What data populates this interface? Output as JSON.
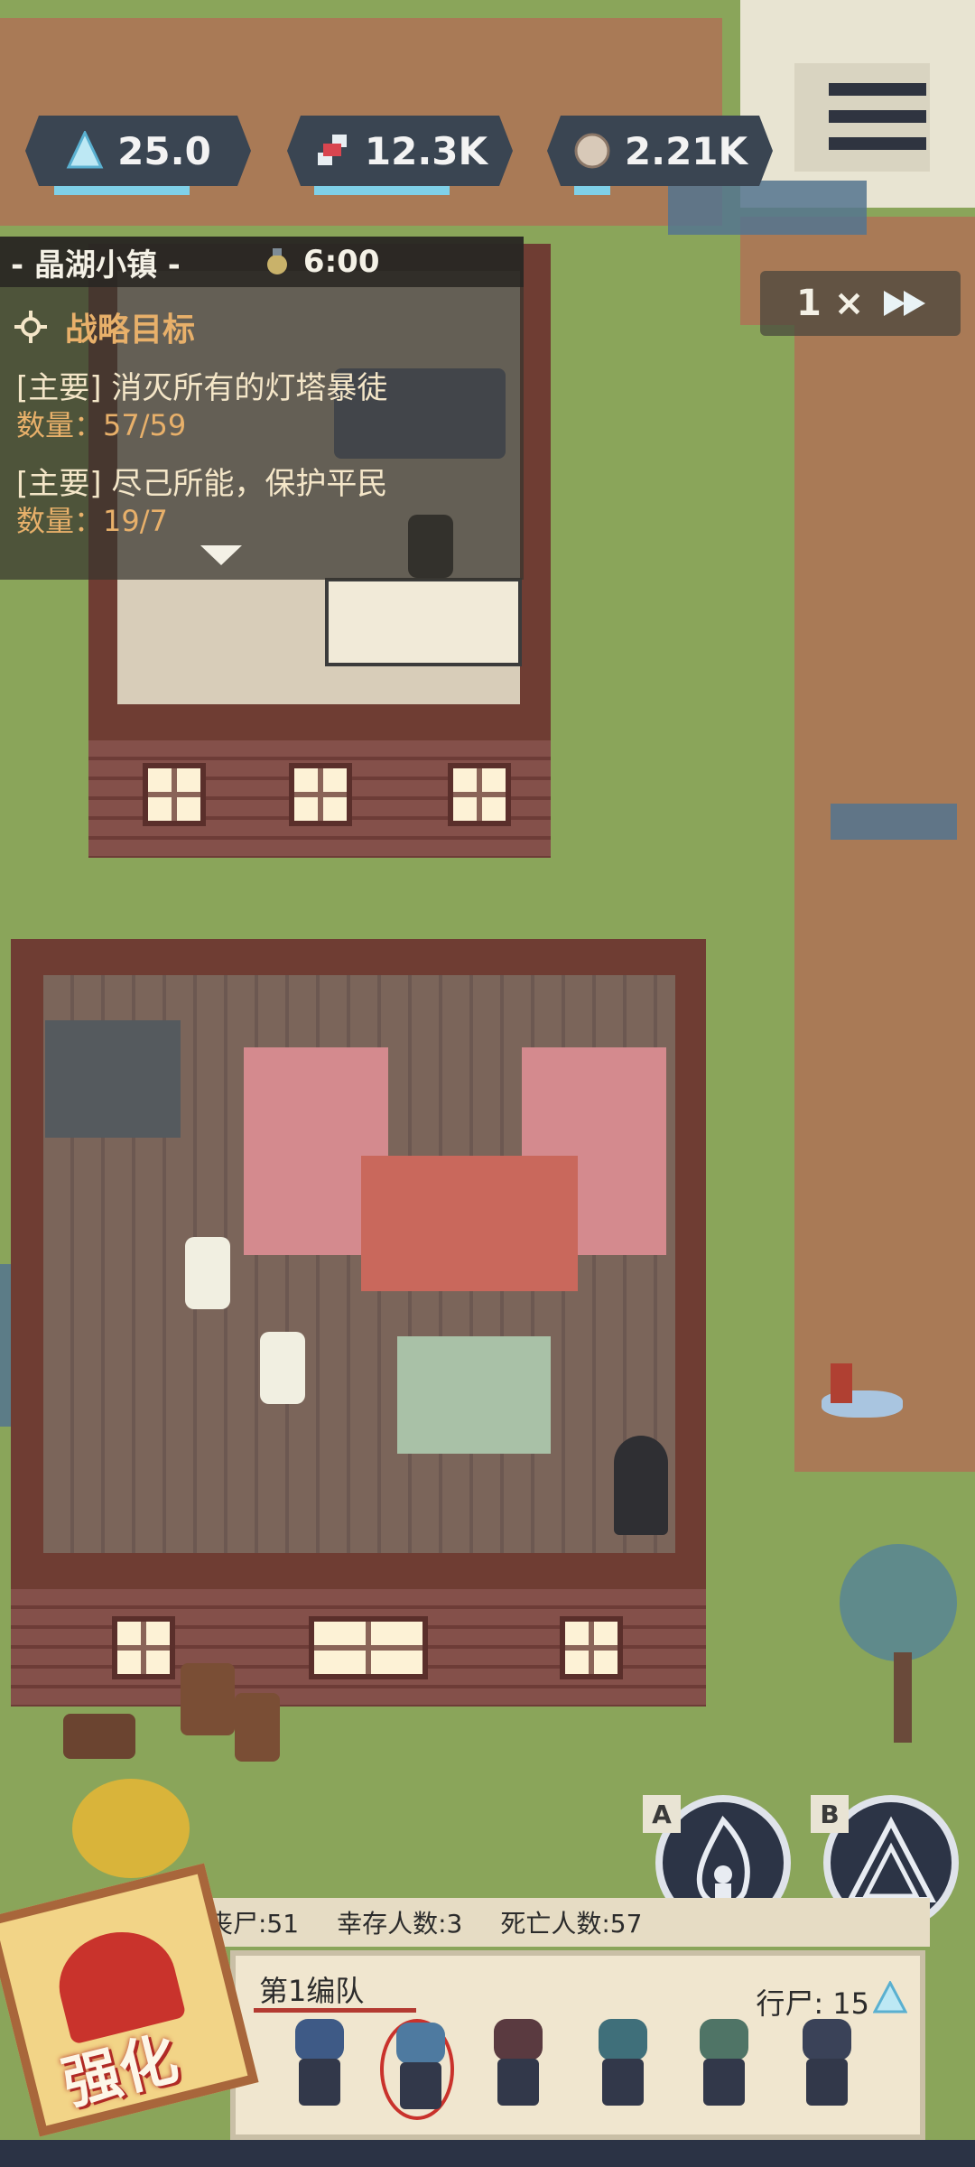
{
  "hud": {
    "resources": [
      {
        "icon": "crystal-icon",
        "value": "25.0"
      },
      {
        "icon": "dna-icon",
        "value": "12.3K"
      },
      {
        "icon": "brain-icon",
        "value": "2.21K"
      }
    ],
    "menu_icon": "hamburger-menu-icon",
    "speed": {
      "label": "1 ×",
      "icon": "fast-forward-icon"
    }
  },
  "mission": {
    "town": "- 晶湖小镇 -",
    "time": "6:00",
    "goal_header": "战略目标",
    "objectives": [
      {
        "text": "[主要] 消灭所有的灯塔暴徒",
        "count": "数量：57/59"
      },
      {
        "text": "[主要] 尽己所能，保护平民",
        "count": "数量：19/7"
      }
    ],
    "collapse_icon": "chevron-down-icon"
  },
  "abilities": [
    {
      "key": "A",
      "icon": "fire-skill-icon"
    },
    {
      "key": "B",
      "icon": "triangle-skill-icon"
    }
  ],
  "stats": {
    "zombies": "丧尸:51",
    "survivors": "幸存人数:3",
    "dead": "死亡人数:57"
  },
  "squad": {
    "title": "第1编队",
    "walker_count": "行尸: 15",
    "units": [
      {
        "name": "unit-1",
        "color": "#3e5a86"
      },
      {
        "name": "unit-2",
        "color": "#4e7aa0"
      },
      {
        "name": "unit-3",
        "color": "#5a3a40"
      },
      {
        "name": "unit-4",
        "color": "#3f6f7a"
      },
      {
        "name": "unit-5",
        "color": "#4f7466"
      },
      {
        "name": "unit-6",
        "color": "#3a4258"
      }
    ]
  },
  "upgrade": {
    "label": "强化"
  }
}
